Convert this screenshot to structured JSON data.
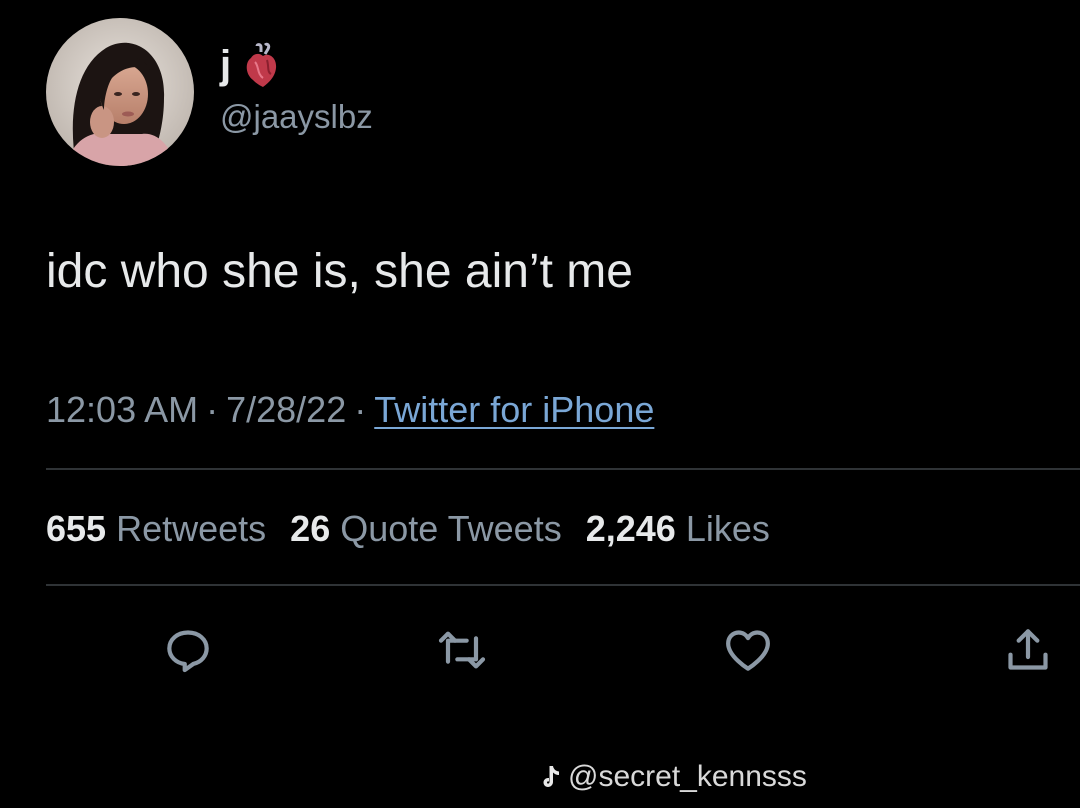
{
  "author": {
    "display_name": "j",
    "handle": "@jaayslbz",
    "avatar_icon": "profile-photo-avatar",
    "name_emoji_icon": "anatomical-heart-icon"
  },
  "tweet": {
    "text": "idc who she is, she ain’t me",
    "time": "12:03 AM",
    "date": "7/28/22",
    "separator": "·",
    "source": "Twitter for iPhone"
  },
  "stats": {
    "retweets": {
      "count": "655",
      "label": "Retweets"
    },
    "quote_tweets": {
      "count": "26",
      "label": "Quote Tweets"
    },
    "likes": {
      "count": "2,246",
      "label": "Likes"
    }
  },
  "actions": {
    "reply_icon": "reply-icon",
    "retweet_icon": "retweet-icon",
    "like_icon": "heart-icon",
    "share_icon": "share-icon"
  },
  "watermark": {
    "text": "@secret_kennsss",
    "icon": "tiktok-logo-icon"
  },
  "colors": {
    "background": "#000000",
    "primary_text": "#e7e9ea",
    "secondary_text": "#8b98a5",
    "link": "#7aa7d6",
    "divider": "#2f3336"
  }
}
